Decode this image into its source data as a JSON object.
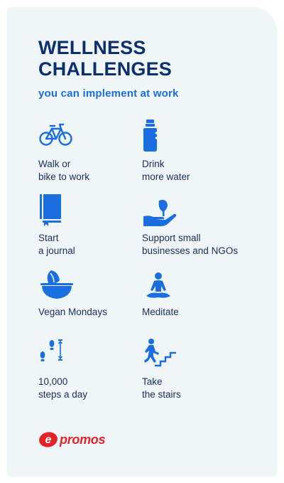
{
  "header": {
    "title_line1": "WELLNESS",
    "title_line2": "CHALLENGES",
    "subtitle": "you can implement at work"
  },
  "challenges": [
    {
      "icon": "bicycle-icon",
      "line1": "Walk or",
      "line2": "bike to work"
    },
    {
      "icon": "water-bottle-icon",
      "line1": "Drink",
      "line2": "more water"
    },
    {
      "icon": "journal-icon",
      "line1": "Start",
      "line2": "a journal"
    },
    {
      "icon": "hand-plant-icon",
      "line1": "Support small",
      "line2": "businesses and NGOs"
    },
    {
      "icon": "vegan-bowl-icon",
      "line1": "Vegan Mondays",
      "line2": ""
    },
    {
      "icon": "meditate-icon",
      "line1": "Meditate",
      "line2": ""
    },
    {
      "icon": "footsteps-icon",
      "line1": "10,000",
      "line2": "steps a day"
    },
    {
      "icon": "stairs-icon",
      "line1": "Take",
      "line2": "the stairs"
    }
  ],
  "brand": {
    "logo_letter": "e",
    "logo_text": "promos"
  },
  "colors": {
    "title": "#0c2f6e",
    "subtitle": "#1a6ee0",
    "icon": "#1a6ee0",
    "brand": "#e2232a",
    "background": "#f0f6f8"
  }
}
